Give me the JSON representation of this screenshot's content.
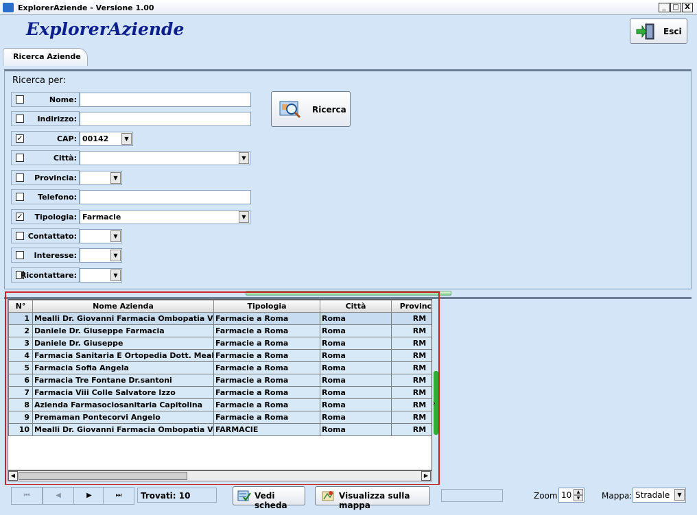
{
  "window": {
    "title": "ExplorerAziende  -  Versione 1.00",
    "min": "_",
    "max": "□",
    "close": "X"
  },
  "header": {
    "brand": "ExplorerAziende",
    "exit_label": "Esci"
  },
  "tabs": [
    {
      "label": "Ricerca Aziende"
    }
  ],
  "search": {
    "heading": "Ricerca per:",
    "button_label": "Ricerca",
    "fields": [
      {
        "label": "Nome:",
        "checked": false,
        "value": ""
      },
      {
        "label": "Indirizzo:",
        "checked": false,
        "value": ""
      },
      {
        "label": "CAP:",
        "checked": true,
        "value": "00142"
      },
      {
        "label": "Città:",
        "checked": false,
        "value": ""
      },
      {
        "label": "Provincia:",
        "checked": false,
        "value": ""
      },
      {
        "label": "Telefono:",
        "checked": false,
        "value": ""
      },
      {
        "label": "Tipologia:",
        "checked": true,
        "value": "Farmacie"
      },
      {
        "label": "Contattato:",
        "checked": false,
        "value": ""
      },
      {
        "label": "Interesse:",
        "checked": false,
        "value": ""
      },
      {
        "label": "Ricontattare:",
        "checked": false,
        "value": ""
      }
    ]
  },
  "results": {
    "columns": [
      "N°",
      "Nome Azienda",
      "Tipologia",
      "Città",
      "Provincia"
    ],
    "rows": [
      [
        "1",
        "Mealli Dr. Giovanni Farmacia Ombopatia Veterinaria",
        "Farmacie a Roma",
        "Roma",
        "RM"
      ],
      [
        "2",
        "Daniele Dr. Giuseppe Farmacia",
        "Farmacie a Roma",
        "Roma",
        "RM"
      ],
      [
        "3",
        "Daniele Dr. Giuseppe",
        "Farmacie a Roma",
        "Roma",
        "RM"
      ],
      [
        "4",
        "Farmacia Sanitaria E Ortopedia Dott. Mealli Paolo",
        "Farmacie a Roma",
        "Roma",
        "RM"
      ],
      [
        "5",
        "Farmacia Sofia Angela",
        "Farmacie a Roma",
        "Roma",
        "RM"
      ],
      [
        "6",
        "Farmacia Tre Fontane Dr.santoni",
        "Farmacie a Roma",
        "Roma",
        "RM"
      ],
      [
        "7",
        "Farmacia Viii Colle Salvatore Izzo",
        "Farmacie a Roma",
        "Roma",
        "RM"
      ],
      [
        "8",
        "Azienda Farmasociosanitaria Capitolina",
        "Farmacie a Roma",
        "Roma",
        "RM"
      ],
      [
        "9",
        "Premaman Pontecorvi Angelo",
        "Farmacie a Roma",
        "Roma",
        "RM"
      ],
      [
        "10",
        "Mealli Dr. Giovanni Farmacia Ombopatia Veterinaria",
        "FARMACIE",
        "Roma",
        "RM"
      ]
    ]
  },
  "footer": {
    "nav": [
      "⏮",
      "◀",
      "▶",
      "⏭"
    ],
    "found": "Trovati: 10",
    "view_card": "Vedi scheda",
    "show_map": "Visualizza sulla mappa",
    "zoom_label": "Zoom",
    "zoom_value": "10",
    "map_label": "Mappa:",
    "map_value": "Stradale"
  },
  "colors": {
    "background": "#d4e5f7",
    "brand": "#0d1f8c",
    "highlight_border": "#cc2222"
  }
}
